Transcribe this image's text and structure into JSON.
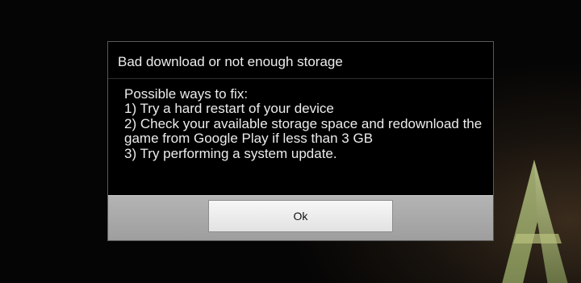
{
  "dialog": {
    "title": "Bad download or not enough storage",
    "message": "Possible ways to fix:\n1) Try a hard restart of your device\n2) Check your available storage space and redownload the game from Google Play if less than 3 GB\n3) Try performing a system update.",
    "ok_label": "Ok"
  },
  "background": {
    "logo_icon": "ark-triangle-logo-icon"
  },
  "colors": {
    "dialog_background": "#000000",
    "button_bar": "#a8a8a8",
    "text": "#ececec"
  }
}
